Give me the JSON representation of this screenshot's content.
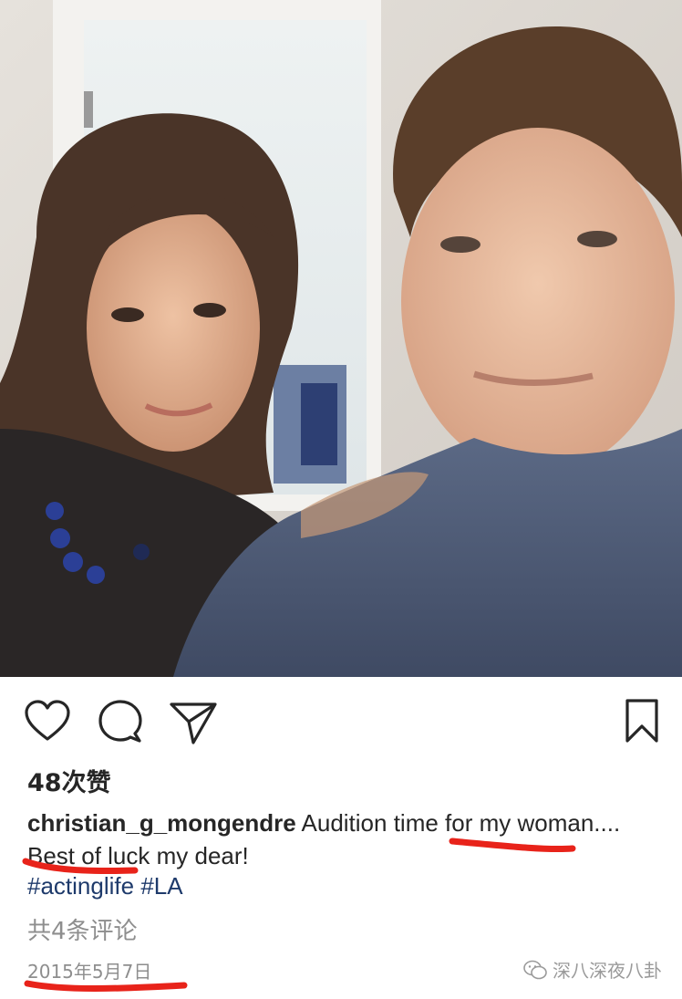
{
  "post": {
    "likes_text": "48次赞",
    "username": "christian_g_mongendre",
    "caption_text": " Audition time for my woman.... Best of luck my dear!",
    "hashtags": [
      "#actinglife",
      "#LA"
    ],
    "comments_text": "共4条评论",
    "date": "2015年5月7日"
  },
  "actions": {
    "like_icon": "heart-icon",
    "comment_icon": "comment-bubble-icon",
    "share_icon": "paper-plane-icon",
    "save_icon": "bookmark-icon"
  },
  "watermark": {
    "text": "深八深夜八卦",
    "icon": "wechat-logo-icon"
  },
  "colors": {
    "text": "#262626",
    "secondary": "#8e8e8e",
    "hashtag": "#1e3a6b",
    "annotation_red": "#e8231a"
  }
}
